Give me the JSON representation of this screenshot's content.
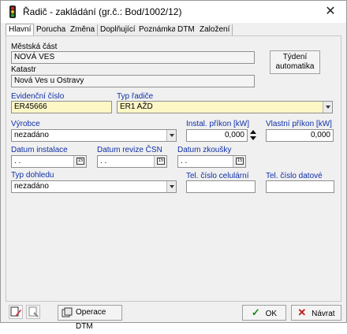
{
  "window": {
    "title": "Řadič - zakládání (gr.č.: Bod/1002/12)",
    "close": "✕"
  },
  "tabs": [
    "Hlavní",
    "Porucha",
    "Změna",
    "Doplňující",
    "Poznámka",
    "DTM",
    "Založení"
  ],
  "form": {
    "mestska_cast": {
      "label": "Městská část",
      "value": "NOVÁ VES"
    },
    "katastr": {
      "label": "Katastr",
      "value": "Nová Ves u Ostravy"
    },
    "tydeni_automatika": {
      "line1": "Týdení",
      "line2": "automatika"
    },
    "evidencni_cislo": {
      "label": "Evidenční číslo",
      "value": "ER45666"
    },
    "typ_radice": {
      "label": "Typ řadiče",
      "value": "ER1 AŽD"
    },
    "vyrobce": {
      "label": "Výrobce",
      "value": "nezadáno"
    },
    "instal_prikon": {
      "label": "Instal. příkon [kW]",
      "value": "0,000"
    },
    "vlastni_prikon": {
      "label": "Vlastní příkon [kW]",
      "value": "0,000"
    },
    "datum_instalace": {
      "label": "Datum instalace",
      "value": ". ."
    },
    "datum_revize": {
      "label": "Datum revize ČSN",
      "value": ". ."
    },
    "datum_zkousky": {
      "label": "Datum zkoušky",
      "value": ". ."
    },
    "typ_dohledu": {
      "label": "Typ dohledu",
      "value": "nezadáno"
    },
    "tel_celularni": {
      "label": "Tel. číslo celulární",
      "value": ""
    },
    "tel_datove": {
      "label": "Tel. číslo datové",
      "value": ""
    },
    "calendar_glyph": "15"
  },
  "footer": {
    "operace_dtm": "Operace DTM",
    "ok": "OK",
    "navrat": "Návrat"
  },
  "colors": {
    "blue_label": "#0f2fa6",
    "required_field": "#fdf7c6"
  }
}
